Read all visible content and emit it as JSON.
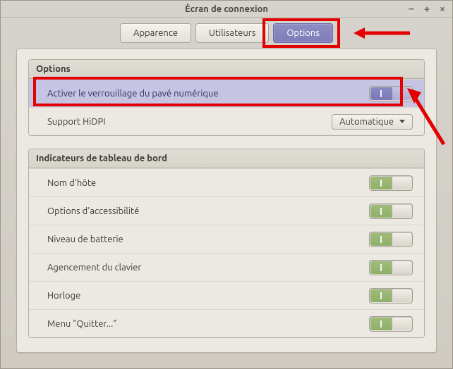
{
  "window": {
    "title": "Écran de connexion",
    "controls": {
      "min": "–",
      "max": "+",
      "close": "×"
    }
  },
  "tabs": [
    {
      "id": "appearance",
      "label": "Apparence",
      "active": false
    },
    {
      "id": "users",
      "label": "Utilisateurs",
      "active": false
    },
    {
      "id": "options",
      "label": "Options",
      "active": true
    }
  ],
  "panels": {
    "options": {
      "title": "Options",
      "rows": {
        "numlock": {
          "label": "Activer le verrouillage du pavé numérique",
          "value": true,
          "highlight": true
        },
        "hidpi": {
          "label": "Support HiDPI",
          "value": "Automatique"
        }
      }
    },
    "indicators": {
      "title": "Indicateurs de tableau de bord",
      "items": [
        {
          "id": "hostname",
          "label": "Nom d'hôte",
          "value": true
        },
        {
          "id": "a11y",
          "label": "Options d'accessibilité",
          "value": true
        },
        {
          "id": "battery",
          "label": "Niveau de batterie",
          "value": true
        },
        {
          "id": "layout",
          "label": "Agencement du clavier",
          "value": true
        },
        {
          "id": "clock",
          "label": "Horloge",
          "value": true
        },
        {
          "id": "quit",
          "label": "Menu \"Quitter...\"",
          "value": true
        }
      ]
    }
  }
}
